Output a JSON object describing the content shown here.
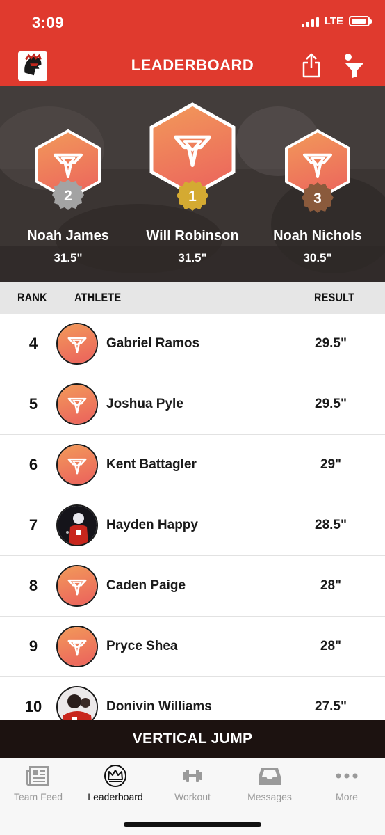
{
  "status_bar": {
    "time": "3:09",
    "network": "LTE"
  },
  "header": {
    "title": "LEADERBOARD"
  },
  "podium": [
    {
      "rank": "2",
      "name": "Noah James",
      "result": "31.5\""
    },
    {
      "rank": "1",
      "name": "Will Robinson",
      "result": "31.5\""
    },
    {
      "rank": "3",
      "name": "Noah Nichols",
      "result": "30.5\""
    }
  ],
  "columns": {
    "rank": "RANK",
    "athlete": "ATHLETE",
    "result": "RESULT"
  },
  "rows": [
    {
      "rank": "4",
      "name": "Gabriel Ramos",
      "result": "29.5\"",
      "avatar": "logo"
    },
    {
      "rank": "5",
      "name": "Joshua Pyle",
      "result": "29.5\"",
      "avatar": "logo"
    },
    {
      "rank": "6",
      "name": "Kent Battagler",
      "result": "29\"",
      "avatar": "logo"
    },
    {
      "rank": "7",
      "name": "Hayden Happy",
      "result": "28.5\"",
      "avatar": "photo"
    },
    {
      "rank": "8",
      "name": "Caden Paige",
      "result": "28\"",
      "avatar": "logo"
    },
    {
      "rank": "9",
      "name": "Pryce Shea",
      "result": "28\"",
      "avatar": "logo"
    },
    {
      "rank": "10",
      "name": "Donivin Williams",
      "result": "27.5\"",
      "avatar": "photo"
    }
  ],
  "event": {
    "name": "VERTICAL JUMP"
  },
  "tabs": [
    {
      "label": "Team Feed",
      "icon": "newspaper-icon",
      "active": false
    },
    {
      "label": "Leaderboard",
      "icon": "crown-icon",
      "active": true
    },
    {
      "label": "Workout",
      "icon": "dumbbell-icon",
      "active": false
    },
    {
      "label": "Messages",
      "icon": "inbox-icon",
      "active": false
    },
    {
      "label": "More",
      "icon": "more-dots-icon",
      "active": false
    }
  ],
  "colors": {
    "brand_red": "#e03a2e",
    "orange_gradient_top": "#f29a5a",
    "orange_gradient_bottom": "#ec6a5c",
    "gold": "#d4aa32",
    "silver": "#a3a3a3",
    "bronze": "#8a5a3c"
  }
}
